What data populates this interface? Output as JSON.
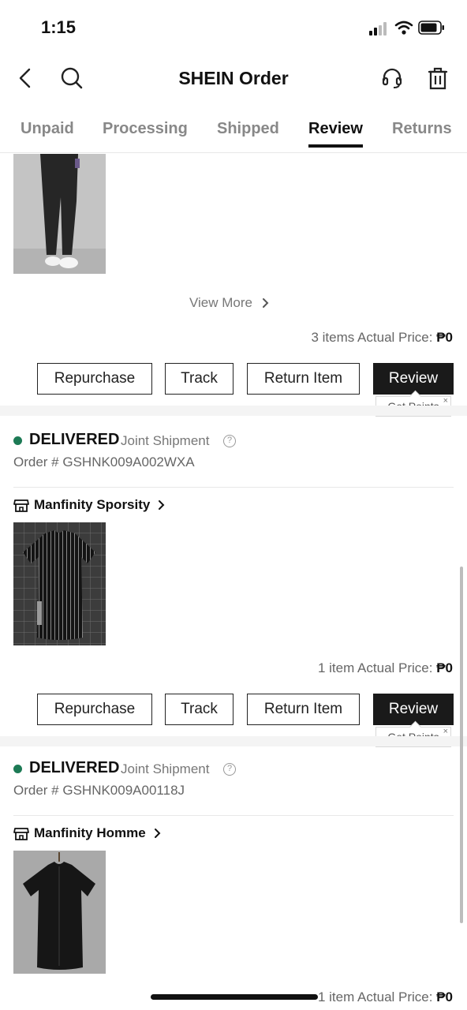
{
  "status": {
    "time": "1:15"
  },
  "header": {
    "title": "SHEIN Order"
  },
  "tabs": [
    "Unpaid",
    "Processing",
    "Shipped",
    "Review",
    "Returns"
  ],
  "active_tab": "Review",
  "order1": {
    "view_more": "View More",
    "summary_prefix": "3 items Actual Price: ",
    "price": "₱0",
    "buttons": {
      "repurchase": "Repurchase",
      "track": "Track",
      "return": "Return Item",
      "review": "Review"
    },
    "tooltip": "Get Points",
    "tooltip_close": "×"
  },
  "order2": {
    "status": "DELIVERED",
    "shipment": "Joint Shipment",
    "help": "?",
    "order_no": "Order #  GSHNK009A002WXA",
    "store": "Manfinity Sporsity",
    "summary_prefix": "1 item Actual Price: ",
    "price": "₱0",
    "buttons": {
      "repurchase": "Repurchase",
      "track": "Track",
      "return": "Return Item",
      "review": "Review"
    },
    "tooltip": "Get Points",
    "tooltip_close": "×"
  },
  "order3": {
    "status": "DELIVERED",
    "shipment": "Joint Shipment",
    "help": "?",
    "order_no": "Order #  GSHNK009A00118J",
    "store": "Manfinity Homme",
    "summary_prefix": "1 item Actual Price: ",
    "price": "₱0"
  },
  "colors": {
    "delivered_dot": "#1d7a55",
    "review_button": "#1a1a1a",
    "tab_active": "#111111",
    "tab_inactive": "#888888"
  }
}
